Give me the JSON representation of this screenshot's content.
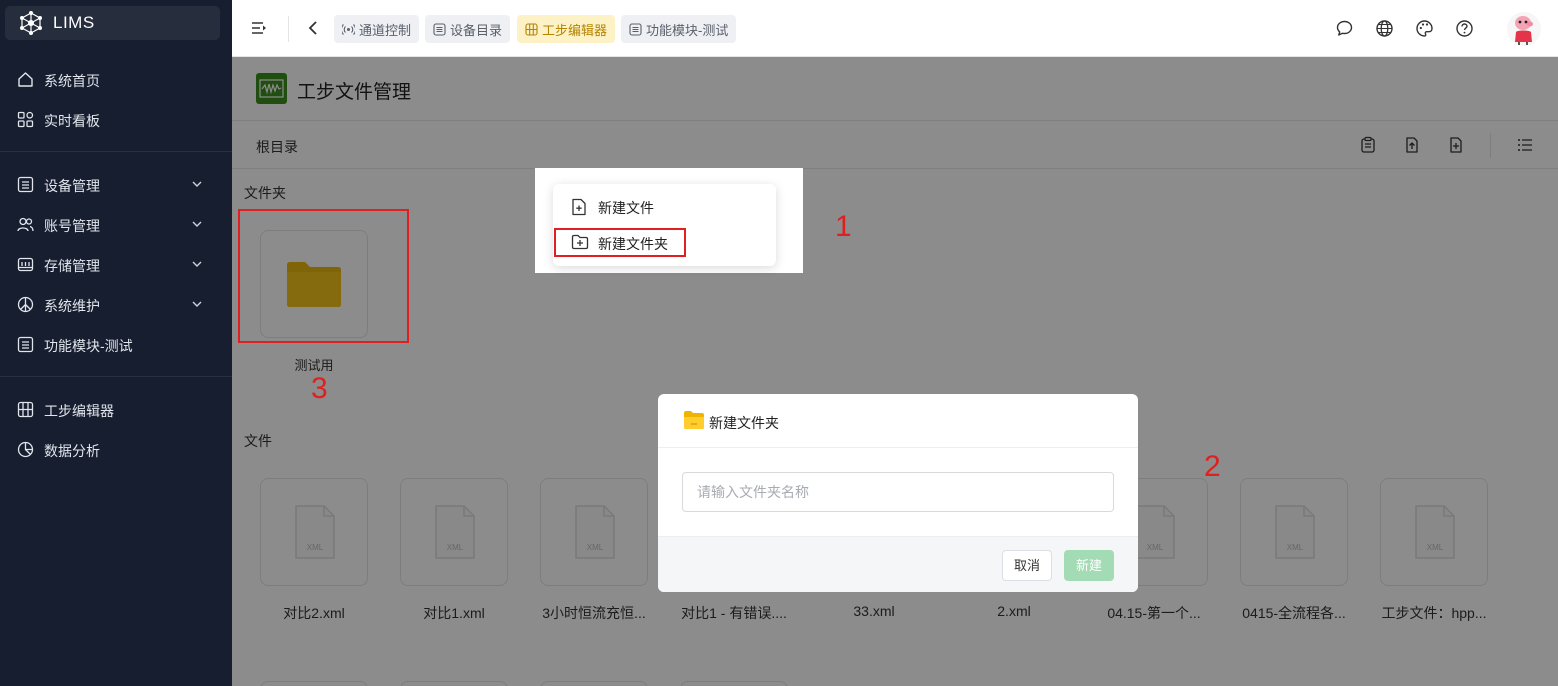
{
  "app": {
    "name": "LIMS"
  },
  "sidebar": {
    "items": [
      {
        "label": "系统首页",
        "icon": "home-icon"
      },
      {
        "label": "实时看板",
        "icon": "dashboard-icon"
      },
      {
        "label": "设备管理",
        "icon": "list-box-icon",
        "expandable": true
      },
      {
        "label": "账号管理",
        "icon": "users-icon",
        "expandable": true
      },
      {
        "label": "存储管理",
        "icon": "storage-icon",
        "expandable": true
      },
      {
        "label": "系统维护",
        "icon": "peace-icon",
        "expandable": true
      },
      {
        "label": "功能模块-测试",
        "icon": "list-box-icon"
      },
      {
        "label": "工步编辑器",
        "icon": "grid-icon"
      },
      {
        "label": "数据分析",
        "icon": "pie-icon"
      }
    ]
  },
  "topbar": {
    "tabs": [
      {
        "label": "通道控制",
        "icon": "broadcast-icon",
        "active": false
      },
      {
        "label": "设备目录",
        "icon": "list-box-icon",
        "active": false
      },
      {
        "label": "工步编辑器",
        "icon": "grid-icon",
        "active": true
      },
      {
        "label": "功能模块-测试",
        "icon": "list-box-icon",
        "active": false
      }
    ],
    "right_icons": [
      "chat-icon",
      "globe-icon",
      "palette-icon",
      "help-icon"
    ]
  },
  "page": {
    "title": "工步文件管理",
    "path": "根目录",
    "folders_section": "文件夹",
    "files_section": "文件",
    "folders": [
      {
        "name": "测试用"
      }
    ],
    "files": [
      {
        "name": "对比2.xml"
      },
      {
        "name": "对比1.xml"
      },
      {
        "name": "3小时恒流充恒..."
      },
      {
        "name": "对比1 - 有错误...."
      },
      {
        "name": "33.xml"
      },
      {
        "name": "2.xml"
      },
      {
        "name": "04.15-第一个..."
      },
      {
        "name": "0415-全流程各..."
      },
      {
        "name": "工步文件：hpp..."
      }
    ],
    "file_type_badge": "XML"
  },
  "context_menu": {
    "items": [
      {
        "label": "新建文件",
        "icon": "file-plus-icon"
      },
      {
        "label": "新建文件夹",
        "icon": "folder-plus-icon"
      }
    ]
  },
  "dialog": {
    "title": "新建文件夹",
    "input_placeholder": "请输入文件夹名称",
    "input_value": "",
    "cancel_label": "取消",
    "create_label": "新建"
  },
  "annotations": [
    "1",
    "2",
    "3"
  ],
  "colors": {
    "sidebar_bg": "#161e2f",
    "active_tab_bg": "#fdf1c6",
    "active_tab_text": "#b58400",
    "folder": "#e8b80e",
    "create_button": "#a3dbb4",
    "annotation": "#e02020"
  }
}
